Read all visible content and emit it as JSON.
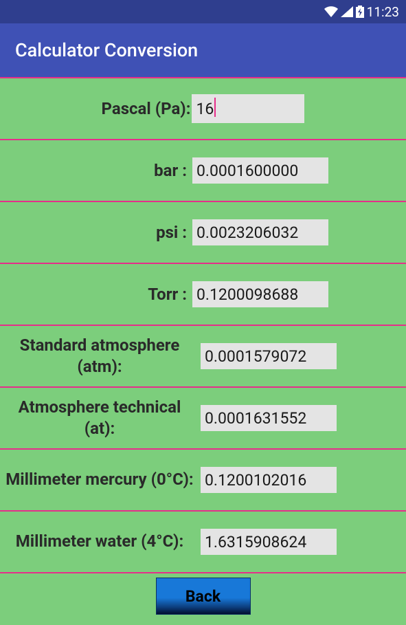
{
  "status": {
    "time": "11:23"
  },
  "header": {
    "title": "Calculator Conversion"
  },
  "rows": {
    "pascal": {
      "label": "Pascal (Pa):",
      "value": "16"
    },
    "bar": {
      "label": "bar :",
      "value": "0.0001600000"
    },
    "psi": {
      "label": "psi :",
      "value": "0.0023206032"
    },
    "torr": {
      "label": "Torr :",
      "value": "0.1200098688"
    },
    "atm": {
      "label": "Standard atmosphere (atm):",
      "value": "0.0001579072"
    },
    "at": {
      "label": "Atmosphere technical (at):",
      "value": "0.0001631552"
    },
    "mmhg": {
      "label": "Millimeter mercury (0°C):",
      "value": "0.1200102016"
    },
    "mmh2o": {
      "label": "Millimeter water (4°C):",
      "value": "1.6315908624"
    }
  },
  "footer": {
    "back_label": "Back"
  }
}
